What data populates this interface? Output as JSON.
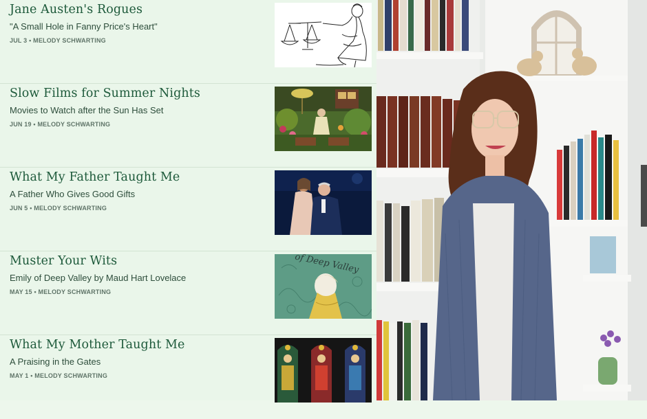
{
  "posts": [
    {
      "title": "Jane Austen's Rogues",
      "subtitle": "\"A Small Hole in Fanny Price's Heart\"",
      "date": "JUL 3",
      "author": "MELODY SCHWARTING",
      "thumb_icon": "woman-with-scales-illustration"
    },
    {
      "title": "Slow Films for Summer Nights",
      "subtitle": "Movies to Watch after the Sun Has Set",
      "date": "JUN 19",
      "author": "MELODY SCHWARTING",
      "thumb_icon": "animated-garden-scene"
    },
    {
      "title": "What My Father Taught Me",
      "subtitle": "A Father Who Gives Good Gifts",
      "date": "JUN 5",
      "author": "MELODY SCHWARTING",
      "thumb_icon": "father-daughter-dance-photo"
    },
    {
      "title": "Muster Your Wits",
      "subtitle": "Emily of Deep Valley by Maud Hart Lovelace",
      "date": "MAY 15",
      "author": "MELODY SCHWARTING",
      "thumb_icon": "deep-valley-book-cover"
    },
    {
      "title": "What My Mother Taught Me",
      "subtitle": "A Praising in the Gates",
      "date": "MAY 1",
      "author": "MELODY SCHWARTING",
      "thumb_icon": "stained-glass-window"
    }
  ],
  "meta_separator": "•",
  "thumb_3_lettering": "of Deep Valley",
  "colors": {
    "feed_bg": "#eaf6ea",
    "title": "#1e5a3b",
    "divider": "#d2e3d2"
  },
  "photo_icon": "author-portrait-bookshelf"
}
